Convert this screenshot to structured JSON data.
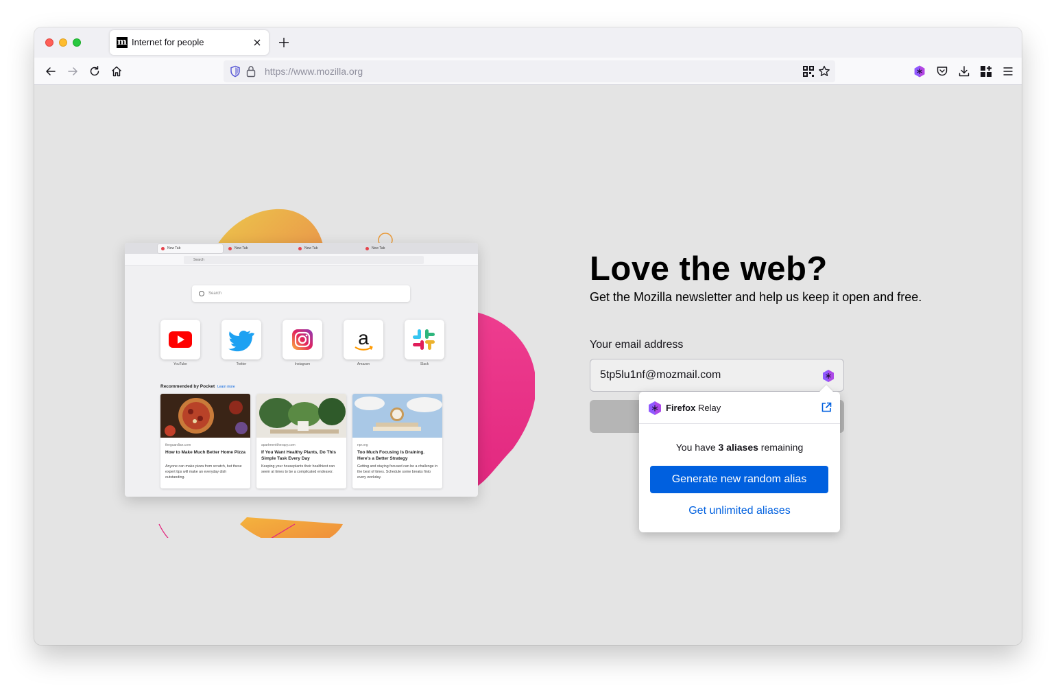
{
  "browser": {
    "tab_title": "Internet for people",
    "tab_favicon_letter": "m",
    "url": "https://www.mozilla.org",
    "icons": {
      "back": "arrow-left-icon",
      "forward": "arrow-right-icon",
      "reload": "reload-icon",
      "home": "home-icon",
      "shield": "tracking-protection-shield-icon",
      "lock": "lock-icon",
      "qr": "qr-code-icon",
      "bookmark": "star-icon",
      "relay": "firefox-relay-icon",
      "pocket": "pocket-icon",
      "downloads": "download-icon",
      "extensions": "extensions-icon",
      "menu": "hamburger-menu-icon"
    }
  },
  "illustration": {
    "tabs": [
      "New Tab",
      "New Tab",
      "New Tab",
      "New Tab"
    ],
    "search_placeholder": "Search",
    "url_placeholder": "Search",
    "top_sites": [
      "YouTube",
      "Twitter",
      "Instagram",
      "Amazon",
      "Slack"
    ],
    "recommended_title": "Recommended by Pocket",
    "learn_more": "Learn more",
    "cards": [
      {
        "source": "theguardian.com",
        "title": "How to Make Much Better Home Pizza",
        "desc": "Anyone can make pizza from scratch, but these expert tips will make an everyday dish outstanding."
      },
      {
        "source": "apartmenttherapy.com",
        "title": "If You Want Healthy Plants, Do This Simple Task Every Day",
        "desc": "Keeping your houseplants their healthiest can seem at times to be a complicated endeavor."
      },
      {
        "source": "npr.org",
        "title": "Too Much Focusing Is Draining. Here's a Better Strategy",
        "desc": "Getting and staying focused can be a challenge in the best of times. Schedule some breaks finto every workday."
      }
    ]
  },
  "newsletter": {
    "heading": "Love the web?",
    "subheading": "Get the Mozilla newsletter and help us keep it open and free.",
    "email_label": "Your email address",
    "email_value": "5tp5lu1nf@mozmail.com"
  },
  "relay": {
    "brand_bold": "Firefox",
    "brand_rest": "Relay",
    "remaining_prefix": "You have ",
    "remaining_count": "3 aliases",
    "remaining_suffix": " remaining",
    "generate_label": "Generate new random alias",
    "unlimited_label": "Get unlimited aliases"
  },
  "colors": {
    "accent": "#0060df",
    "relay_purple": "#9059ff",
    "page_bg": "#e4e4e4"
  }
}
